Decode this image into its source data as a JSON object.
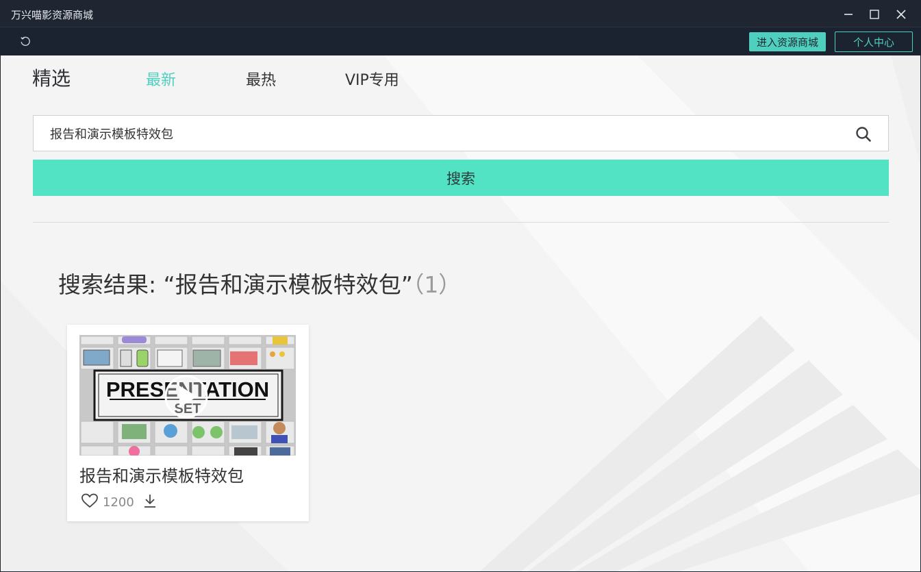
{
  "window": {
    "title": "万兴喵影资源商城",
    "controls": [
      "minimize-icon",
      "maximize-icon",
      "close-icon"
    ]
  },
  "toolbar": {
    "refresh_icon": "refresh-icon",
    "store_button": "进入资源商城",
    "personal_button": "个人中心",
    "accent_color": "#4fd0bf"
  },
  "tabs": [
    {
      "label": "精选"
    },
    {
      "label": "最新",
      "selected": true
    },
    {
      "label": "最热"
    },
    {
      "label": "VIP专用"
    }
  ],
  "search": {
    "value": "报告和演示模板特效包",
    "button_label": "搜索",
    "button_color": "#51e3c4"
  },
  "results": {
    "prefix": "搜索结果: ",
    "query_quoted": "“报告和演示模板特效包”",
    "count": "（1）"
  },
  "cards": [
    {
      "title": "报告和演示模板特效包",
      "likes": "1200",
      "thumbnail_title": "PRESENTATION",
      "thumbnail_subtitle": "SET",
      "like_icon": "heart-icon",
      "download_icon": "download-icon",
      "play_icon": "play-icon"
    }
  ]
}
